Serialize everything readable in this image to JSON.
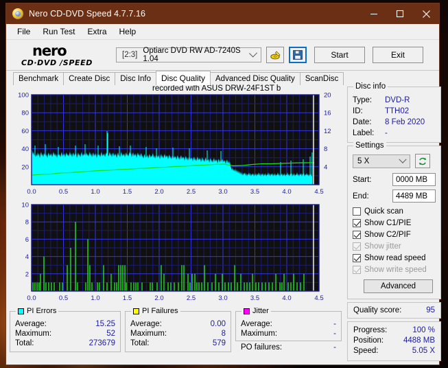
{
  "window": {
    "title": "Nero CD-DVD Speed 4.7.7.16",
    "app_icon": "nero-disc-icon",
    "controls": {
      "minimize": "minimize-icon",
      "maximize": "maximize-icon",
      "close": "close-icon"
    }
  },
  "menubar": {
    "items": [
      "File",
      "Run Test",
      "Extra",
      "Help"
    ]
  },
  "toolbar": {
    "logo_top": "nero",
    "logo_bottom": "CD·DVD ∕SPEED",
    "drive_index": "[2:3]",
    "drive_name": "Optiarc DVD RW AD-7240S 1.04",
    "dropdown_icon": "chevron-down-icon",
    "eject_icon": "eject-disc-icon",
    "save_icon": "floppy-save-icon",
    "start_label": "Start",
    "exit_label": "Exit"
  },
  "tabs": [
    {
      "label": "Benchmark",
      "active": false
    },
    {
      "label": "Create Disc",
      "active": false
    },
    {
      "label": "Disc Info",
      "active": false
    },
    {
      "label": "Disc Quality",
      "active": true
    },
    {
      "label": "Advanced Disc Quality",
      "active": false
    },
    {
      "label": "ScanDisc",
      "active": false
    }
  ],
  "chart_caption": "recorded with ASUS    DRW-24F1ST  b",
  "stats": {
    "pi_errors": {
      "title": "PI Errors",
      "color": "#00ffff",
      "rows": [
        {
          "key": "Average:",
          "value": "15.25"
        },
        {
          "key": "Maximum:",
          "value": "52"
        },
        {
          "key": "Total:",
          "value": "273679"
        }
      ]
    },
    "pi_failures": {
      "title": "PI Failures",
      "color": "#ffff00",
      "rows": [
        {
          "key": "Average:",
          "value": "0.00"
        },
        {
          "key": "Maximum:",
          "value": "8"
        },
        {
          "key": "Total:",
          "value": "579"
        }
      ]
    },
    "jitter": {
      "title": "Jitter",
      "color": "#ff00ff",
      "rows": [
        {
          "key": "Average:",
          "value": "-"
        },
        {
          "key": "Maximum:",
          "value": "-"
        }
      ],
      "po_key": "PO failures:",
      "po_value": "-"
    }
  },
  "disc_info": {
    "title": "Disc info",
    "rows": [
      {
        "key": "Type:",
        "value": "DVD-R"
      },
      {
        "key": "ID:",
        "value": "TTH02"
      },
      {
        "key": "Date:",
        "value": "8 Feb 2020"
      },
      {
        "key": "Label:",
        "value": "-"
      }
    ]
  },
  "settings": {
    "title": "Settings",
    "speed_value": "5 X",
    "speed_chevron": "chevron-down-icon",
    "refresh_icon": "refresh-arrows-icon",
    "start_label": "Start:",
    "start_value": "0000 MB",
    "end_label": "End:",
    "end_value": "4489 MB",
    "checkboxes": [
      {
        "label": "Quick scan",
        "checked": false,
        "disabled": false
      },
      {
        "label": "Show C1/PIE",
        "checked": true,
        "disabled": false
      },
      {
        "label": "Show C2/PIF",
        "checked": true,
        "disabled": false
      },
      {
        "label": "Show jitter",
        "checked": true,
        "disabled": true
      },
      {
        "label": "Show read speed",
        "checked": true,
        "disabled": false
      },
      {
        "label": "Show write speed",
        "checked": true,
        "disabled": true
      }
    ],
    "advanced_label": "Advanced"
  },
  "quality": {
    "label": "Quality score:",
    "value": "95"
  },
  "progress": {
    "rows": [
      {
        "key": "Progress:",
        "value": "100 %"
      },
      {
        "key": "Position:",
        "value": "4488 MB"
      },
      {
        "key": "Speed:",
        "value": "5.05 X"
      }
    ]
  },
  "chart_data": [
    {
      "type": "line",
      "name": "pi-errors-chart",
      "title": "recorded with ASUS    DRW-24F1ST  b",
      "xlabel": "",
      "ylabel": "PI Errors",
      "xlim": [
        0.0,
        4.5
      ],
      "ylim": [
        0,
        100
      ],
      "y2lim": [
        0,
        20
      ],
      "xticks": [
        "0.0",
        "0.5",
        "1.0",
        "1.5",
        "2.0",
        "2.5",
        "3.0",
        "3.5",
        "4.0",
        "4.5"
      ],
      "yticks": [
        "20",
        "40",
        "60",
        "80",
        "100"
      ],
      "y2ticks": [
        "4",
        "8",
        "12",
        "16",
        "20"
      ],
      "grid": true,
      "background": "#101010",
      "gridcolor": "#2020d0",
      "series": [
        {
          "name": "PI Errors (filled)",
          "color": "#00ffff",
          "fill": true,
          "x": [
            0.0,
            0.05,
            0.1,
            0.15,
            0.2,
            0.25,
            0.3,
            0.35,
            0.4,
            0.45,
            0.5,
            0.55,
            0.6,
            0.65,
            0.7,
            0.75,
            0.8,
            0.85,
            0.9,
            0.95,
            1.0,
            1.05,
            1.1,
            1.15,
            1.2,
            1.25,
            1.3,
            1.35,
            1.4,
            1.45,
            1.5,
            1.55,
            1.6,
            1.65,
            1.7,
            1.75,
            1.8,
            1.85,
            1.9,
            1.95,
            2.0,
            2.05,
            2.1,
            2.15,
            2.2,
            2.25,
            2.3,
            2.35,
            2.4,
            2.45,
            2.5,
            2.55,
            2.6,
            2.65,
            2.7,
            2.75,
            2.8,
            2.85,
            2.9,
            2.95,
            3.0,
            3.05,
            3.1,
            3.15,
            3.2,
            3.25,
            3.3,
            3.35,
            3.4,
            3.45,
            3.5,
            3.55,
            3.6,
            3.65,
            3.7,
            3.75,
            3.8,
            3.85,
            3.9,
            3.95,
            4.0,
            4.05,
            4.1,
            4.15,
            4.2,
            4.25,
            4.3,
            4.35,
            4.4
          ],
          "y": [
            40,
            33,
            34,
            38,
            32,
            30,
            34,
            29,
            31,
            33,
            29,
            32,
            28,
            30,
            34,
            28,
            31,
            27,
            33,
            29,
            31,
            35,
            30,
            52,
            33,
            30,
            34,
            28,
            32,
            30,
            29,
            33,
            31,
            28,
            34,
            30,
            32,
            27,
            31,
            29,
            33,
            28,
            30,
            32,
            27,
            29,
            31,
            28,
            25,
            30,
            27,
            29,
            26,
            31,
            28,
            26,
            29,
            25,
            28,
            26,
            29,
            27,
            24,
            26,
            28,
            25,
            27,
            24,
            20,
            18,
            17,
            19,
            16,
            18,
            15,
            17,
            16,
            18,
            15,
            17,
            16,
            18,
            15,
            17,
            16,
            18,
            15,
            17,
            16
          ]
        },
        {
          "name": "Read speed",
          "color": "#00e000",
          "fill": false,
          "axis": "right",
          "x": [
            0.0,
            0.3,
            0.6,
            0.9,
            1.2,
            1.5,
            1.8,
            2.1,
            2.4,
            2.7,
            3.0,
            3.3,
            3.6,
            3.9,
            4.2,
            4.4
          ],
          "y": [
            2.0,
            2.2,
            2.4,
            2.6,
            2.8,
            3.0,
            3.2,
            3.35,
            3.5,
            3.7,
            3.85,
            4.0,
            4.25,
            4.45,
            4.6,
            4.65
          ]
        }
      ]
    },
    {
      "type": "bar",
      "name": "pi-failures-chart",
      "xlabel": "",
      "ylabel": "PI Failures",
      "xlim": [
        0.0,
        4.5
      ],
      "ylim": [
        0,
        10
      ],
      "xticks": [
        "0.0",
        "0.5",
        "1.0",
        "1.5",
        "2.0",
        "2.5",
        "3.0",
        "3.5",
        "4.0",
        "4.5"
      ],
      "yticks": [
        "2",
        "4",
        "6",
        "8",
        "10"
      ],
      "grid": true,
      "background": "#101010",
      "gridcolor": "#2020d0",
      "color": "#22e022",
      "x": [
        0.02,
        0.05,
        0.08,
        0.11,
        0.14,
        0.19,
        0.23,
        0.27,
        0.31,
        0.35,
        0.43,
        0.47,
        0.56,
        0.61,
        0.68,
        0.71,
        0.84,
        0.87,
        0.9,
        0.93,
        1.02,
        1.05,
        1.12,
        1.17,
        1.24,
        1.29,
        1.33,
        1.36,
        1.39,
        1.42,
        1.45,
        1.48,
        1.55,
        1.6,
        1.63,
        1.66,
        1.72,
        1.85,
        1.88,
        1.96,
        2.02,
        2.06,
        2.12,
        2.16,
        2.22,
        2.28,
        2.33,
        2.37,
        2.43,
        2.46,
        2.49,
        2.53,
        2.56,
        2.59,
        2.63,
        2.67,
        2.72,
        2.78,
        2.83,
        2.88,
        2.93,
        2.97,
        3.02,
        3.07,
        3.11,
        3.16,
        3.21,
        3.26,
        3.31,
        3.35,
        3.39,
        3.44,
        3.48,
        3.53,
        3.58,
        3.63,
        3.68,
        3.73,
        3.78,
        3.83,
        3.88,
        3.94,
        4.0,
        4.03,
        4.06,
        4.12,
        4.16,
        4.21,
        4.26,
        4.31,
        4.36
      ],
      "y": [
        1,
        1,
        1,
        1,
        2,
        4,
        1,
        1,
        1,
        1,
        1,
        1,
        3,
        6,
        8,
        1,
        1,
        6,
        3,
        1,
        1,
        1,
        3,
        1,
        2,
        1,
        1,
        3,
        3,
        3,
        3,
        1,
        1,
        1,
        1,
        1,
        1,
        1,
        1,
        1,
        3,
        2,
        1,
        1,
        1,
        1,
        3,
        3,
        2,
        1,
        2,
        2,
        1,
        1,
        1,
        3,
        1,
        1,
        2,
        1,
        2,
        1,
        1,
        1,
        3,
        1,
        2,
        1,
        1,
        1,
        2,
        1,
        1,
        1,
        1,
        1,
        1,
        2,
        1,
        1,
        2,
        1,
        1,
        2,
        1,
        1,
        2,
        1,
        1,
        1,
        2
      ]
    }
  ]
}
